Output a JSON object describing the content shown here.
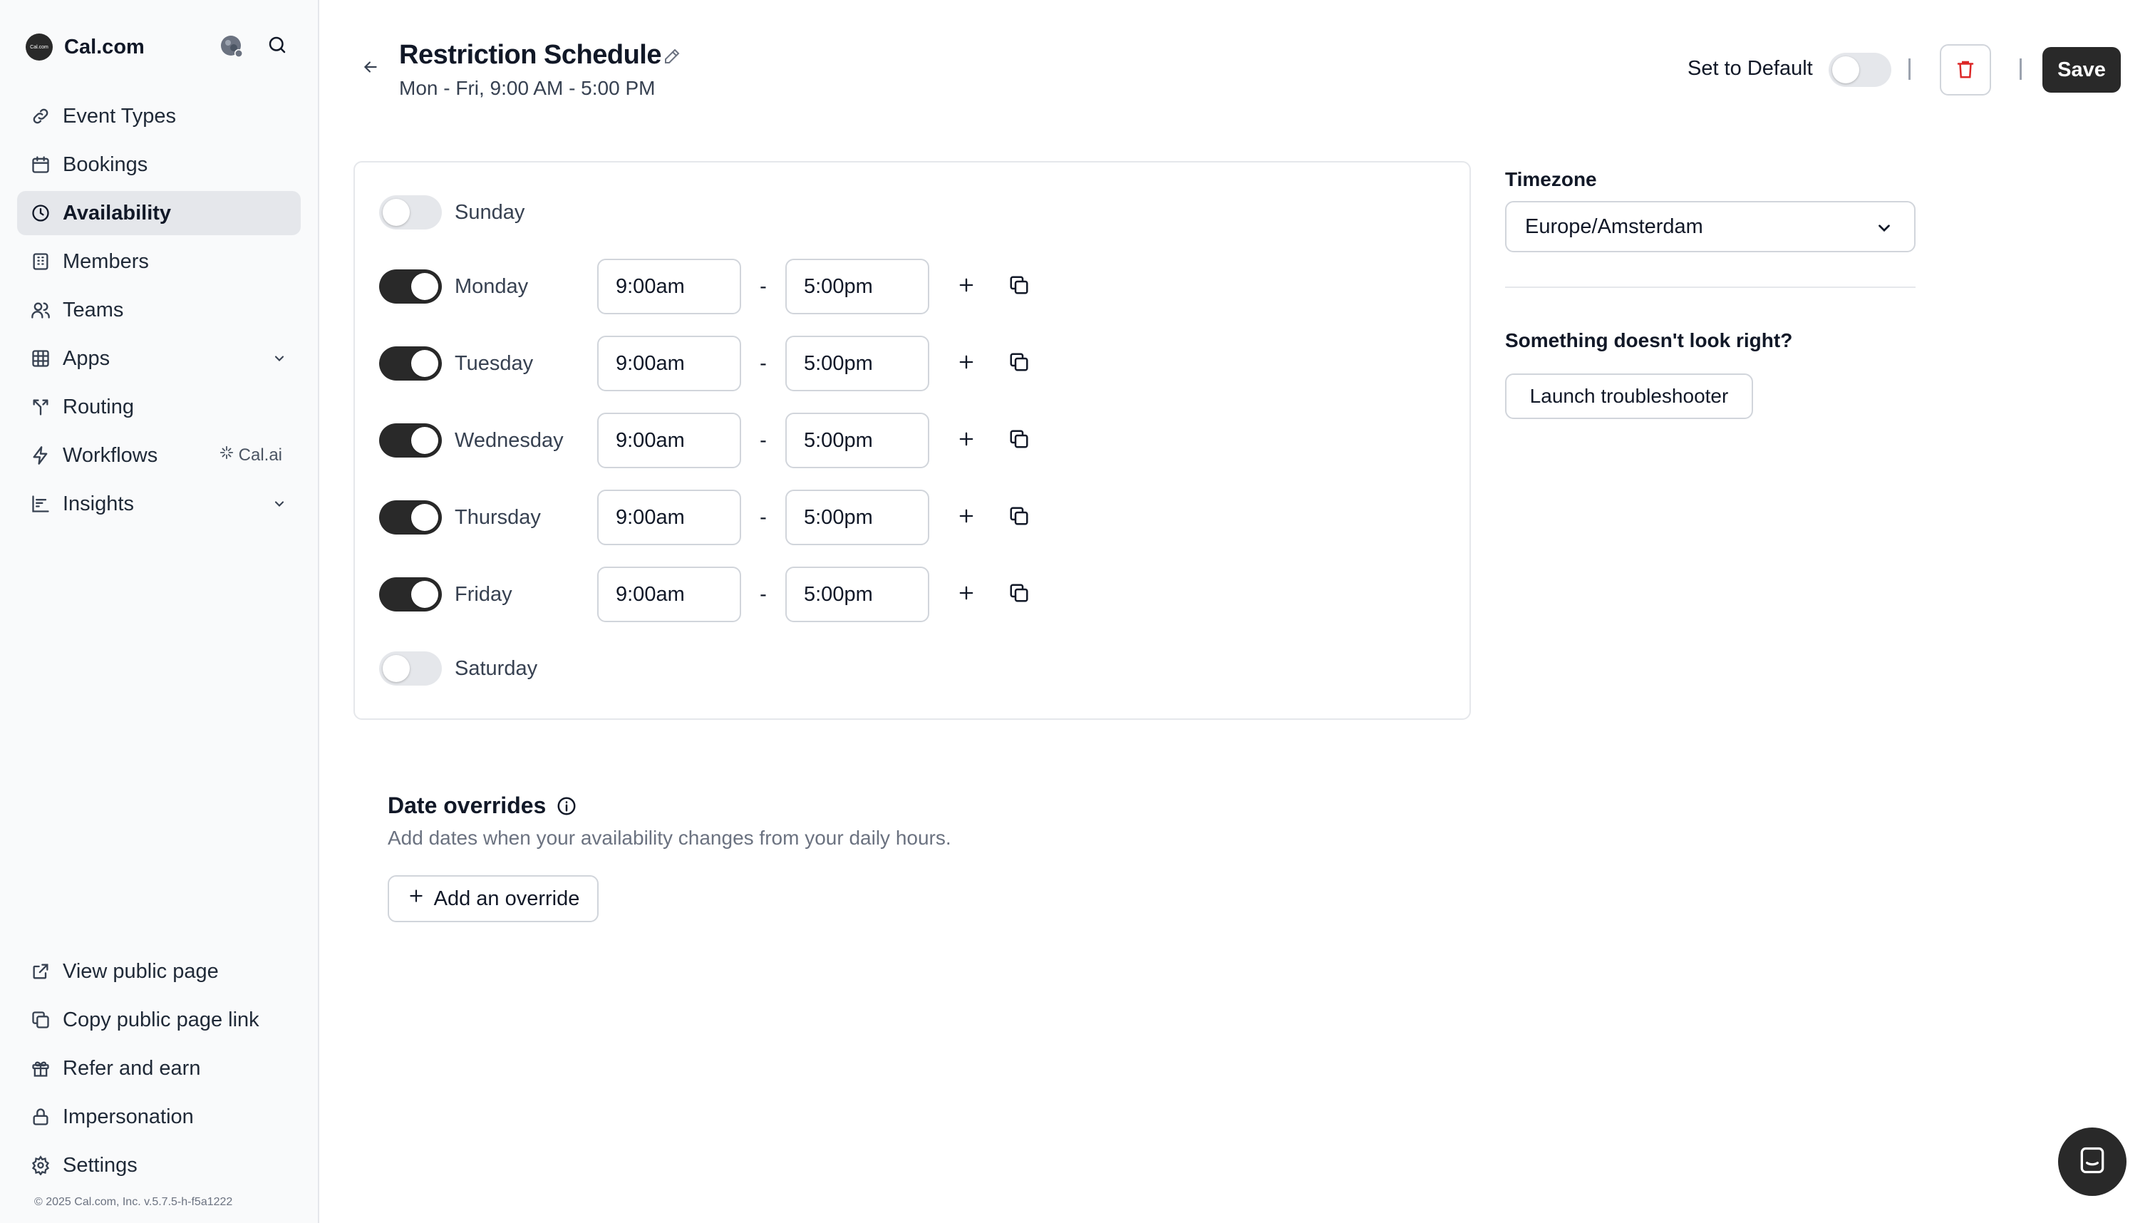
{
  "brand": {
    "name": "Cal.com",
    "logo_text": "Cal.com"
  },
  "nav": {
    "items": [
      {
        "label": "Event Types",
        "icon": "link-icon"
      },
      {
        "label": "Bookings",
        "icon": "calendar-icon"
      },
      {
        "label": "Availability",
        "icon": "clock-icon",
        "active": true
      },
      {
        "label": "Members",
        "icon": "building-icon"
      },
      {
        "label": "Teams",
        "icon": "users-icon"
      },
      {
        "label": "Apps",
        "icon": "grid-icon",
        "expandable": true
      },
      {
        "label": "Routing",
        "icon": "split-icon"
      },
      {
        "label": "Workflows",
        "icon": "zap-icon",
        "badge": "Cal.ai"
      },
      {
        "label": "Insights",
        "icon": "bar-chart-icon",
        "expandable": true
      }
    ],
    "bottom_items": [
      {
        "label": "View public page",
        "icon": "external-link-icon"
      },
      {
        "label": "Copy public page link",
        "icon": "copy-icon"
      },
      {
        "label": "Refer and earn",
        "icon": "gift-icon"
      },
      {
        "label": "Impersonation",
        "icon": "lock-icon"
      },
      {
        "label": "Settings",
        "icon": "gear-icon"
      }
    ],
    "footer": "© 2025 Cal.com, Inc. v.5.7.5-h-f5a1222"
  },
  "header": {
    "title": "Restriction Schedule",
    "subtitle": "Mon - Fri, 9:00 AM - 5:00 PM",
    "set_default_label": "Set to Default",
    "set_default_on": false,
    "save_label": "Save"
  },
  "schedule": {
    "days": [
      {
        "name": "Sunday",
        "enabled": false
      },
      {
        "name": "Monday",
        "enabled": true,
        "start": "9:00am",
        "end": "5:00pm"
      },
      {
        "name": "Tuesday",
        "enabled": true,
        "start": "9:00am",
        "end": "5:00pm"
      },
      {
        "name": "Wednesday",
        "enabled": true,
        "start": "9:00am",
        "end": "5:00pm"
      },
      {
        "name": "Thursday",
        "enabled": true,
        "start": "9:00am",
        "end": "5:00pm"
      },
      {
        "name": "Friday",
        "enabled": true,
        "start": "9:00am",
        "end": "5:00pm"
      },
      {
        "name": "Saturday",
        "enabled": false
      }
    ],
    "separator": "-"
  },
  "timezone": {
    "label": "Timezone",
    "value": "Europe/Amsterdam"
  },
  "troubleshoot": {
    "title": "Something doesn't look right?",
    "button": "Launch troubleshooter"
  },
  "overrides": {
    "title": "Date overrides",
    "description": "Add dates when your availability changes from your daily hours.",
    "button": "Add an override"
  },
  "colors": {
    "accent": "#292929",
    "sidebar_bg": "#f9fafb",
    "active_nav_bg": "#e5e7eb",
    "delete_icon": "#dc2626"
  }
}
